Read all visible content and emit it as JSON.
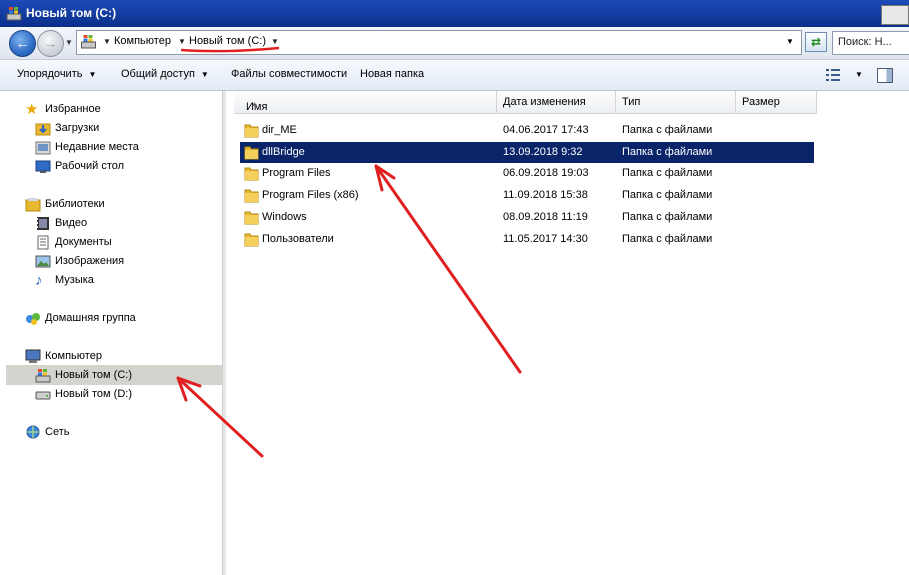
{
  "window": {
    "title": "Новый том (C:)"
  },
  "address": {
    "crumbs": [
      "Компьютер",
      "Новый том (C:)"
    ]
  },
  "search": {
    "placeholder": "Поиск: Н..."
  },
  "toolbar": {
    "organize": "Упорядочить",
    "share": "Общий доступ",
    "compat": "Файлы совместимости",
    "new_folder": "Новая папка"
  },
  "nav": {
    "favorites": "Избранное",
    "downloads": "Загрузки",
    "recent": "Недавние места",
    "desktop": "Рабочий стол",
    "libraries": "Библиотеки",
    "video": "Видео",
    "documents": "Документы",
    "images": "Изображения",
    "music": "Музыка",
    "homegroup": "Домашняя группа",
    "computer": "Компьютер",
    "drive_c": "Новый том (C:)",
    "drive_d": "Новый том (D:)",
    "network": "Сеть"
  },
  "columns": {
    "name": "Имя",
    "date": "Дата изменения",
    "type": "Тип",
    "size": "Размер"
  },
  "files": [
    {
      "name": "dir_ME",
      "date": "04.06.2017 17:43",
      "type": "Папка с файлами"
    },
    {
      "name": "dllBridge",
      "date": "13.09.2018 9:32",
      "type": "Папка с файлами"
    },
    {
      "name": "Program Files",
      "date": "06.09.2018 19:03",
      "type": "Папка с файлами"
    },
    {
      "name": "Program Files (x86)",
      "date": "11.09.2018 15:38",
      "type": "Папка с файлами"
    },
    {
      "name": "Windows",
      "date": "08.09.2018 11:19",
      "type": "Папка с файлами"
    },
    {
      "name": "Пользователи",
      "date": "11.05.2017 14:30",
      "type": "Папка с файлами"
    }
  ],
  "selected_file_index": 1,
  "colors": {
    "selection": "#0a246a",
    "annotation": "#e02020",
    "folder": "#e8b830"
  }
}
